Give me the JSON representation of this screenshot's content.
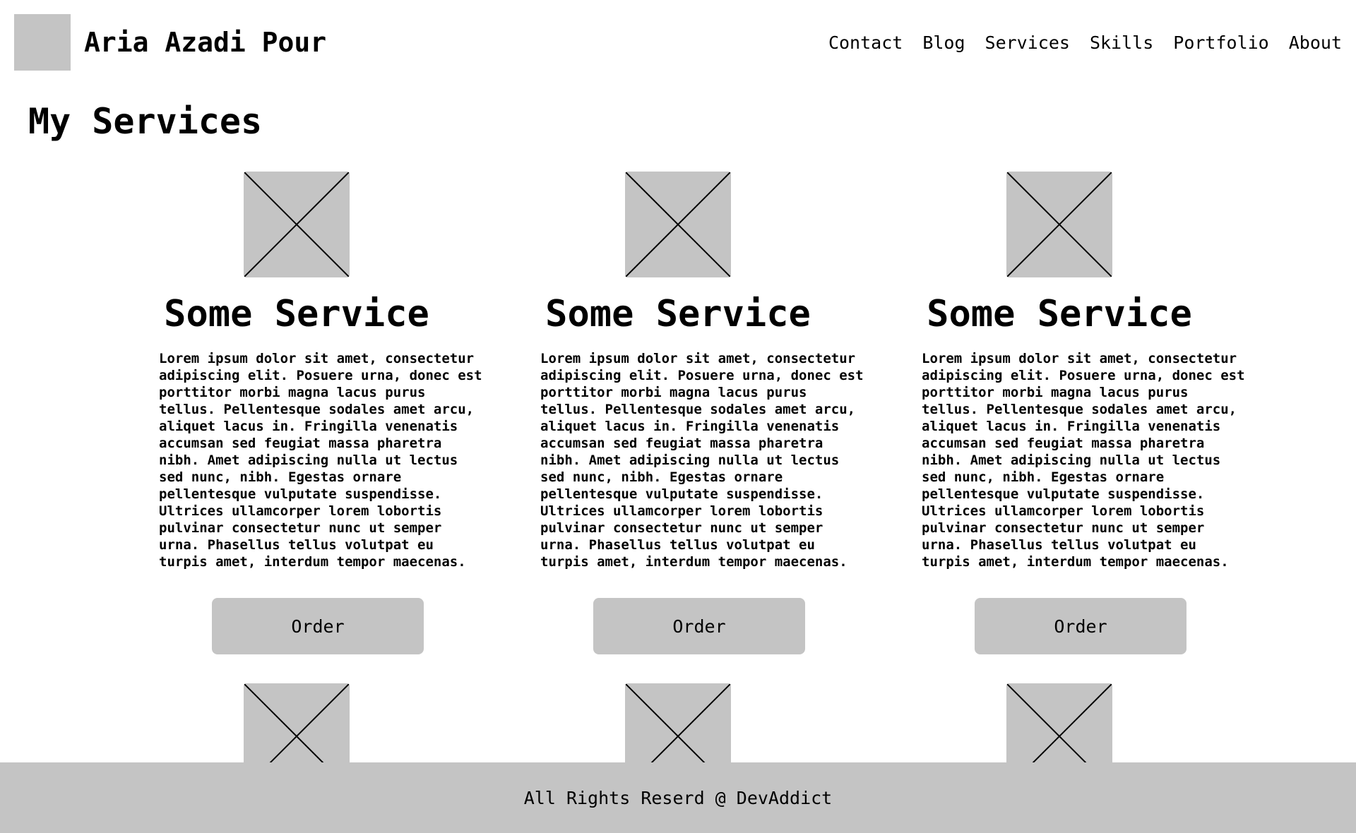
{
  "header": {
    "site_title": "Aria Azadi Pour",
    "nav": [
      "Contact",
      "Blog",
      "Services",
      "Skills",
      "Portfolio",
      "About"
    ]
  },
  "main": {
    "page_title": "My Services",
    "cards": [
      {
        "title": "Some Service",
        "description": "Lorem ipsum dolor sit amet, consectetur adipiscing elit. Posuere urna, donec est porttitor morbi magna lacus purus tellus. Pellentesque sodales amet arcu, aliquet lacus in. Fringilla venenatis accumsan sed feugiat massa pharetra nibh. Amet adipiscing nulla ut lectus sed nunc, nibh. Egestas ornare pellentesque vulputate suspendisse. Ultrices ullamcorper lorem lobortis pulvinar consectetur nunc ut semper urna. Phasellus tellus volutpat eu turpis amet, interdum tempor maecenas.",
        "button_label": "Order"
      },
      {
        "title": "Some Service",
        "description": "Lorem ipsum dolor sit amet, consectetur adipiscing elit. Posuere urna, donec est porttitor morbi magna lacus purus tellus. Pellentesque sodales amet arcu, aliquet lacus in. Fringilla venenatis accumsan sed feugiat massa pharetra nibh. Amet adipiscing nulla ut lectus sed nunc, nibh. Egestas ornare pellentesque vulputate suspendisse. Ultrices ullamcorper lorem lobortis pulvinar consectetur nunc ut semper urna. Phasellus tellus volutpat eu turpis amet, interdum tempor maecenas.",
        "button_label": "Order"
      },
      {
        "title": "Some Service",
        "description": "Lorem ipsum dolor sit amet, consectetur adipiscing elit. Posuere urna, donec est porttitor morbi magna lacus purus tellus. Pellentesque sodales amet arcu, aliquet lacus in. Fringilla venenatis accumsan sed feugiat massa pharetra nibh. Amet adipiscing nulla ut lectus sed nunc, nibh. Egestas ornare pellentesque vulputate suspendisse. Ultrices ullamcorper lorem lobortis pulvinar consectetur nunc ut semper urna. Phasellus tellus volutpat eu turpis amet, interdum tempor maecenas.",
        "button_label": "Order"
      }
    ]
  },
  "footer": {
    "text": "All Rights Reserd @ DevAddict"
  },
  "colors": {
    "placeholder_gray": "#c4c4c4",
    "text": "#000000",
    "background": "#ffffff"
  }
}
